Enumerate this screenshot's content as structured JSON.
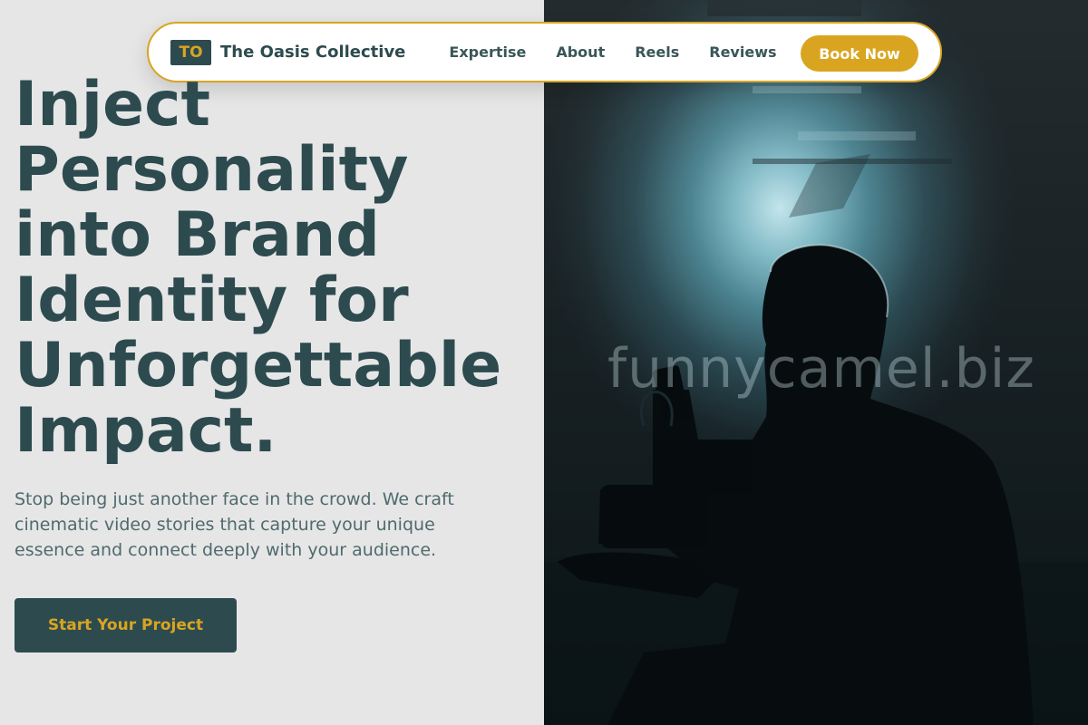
{
  "brand": {
    "badge": "TO",
    "name": "The Oasis Collective"
  },
  "nav": {
    "links": [
      "Expertise",
      "About",
      "Reels",
      "Reviews"
    ],
    "cta_label": "Book Now"
  },
  "hero": {
    "title": "Inject Personality into Brand Identity for Unforgettable Impact.",
    "description": "Stop being just another face in the crowd. We craft cinematic video stories that capture your unique essence and connect deeply with your audience.",
    "cta_label": "Start Your Project"
  },
  "image": {
    "watermark": "funnycamel.biz",
    "subject": "silhouette-videographer-with-camera"
  },
  "colors": {
    "primary": "#2d4b4f",
    "accent": "#d9a521",
    "background": "#e6e6e6"
  }
}
